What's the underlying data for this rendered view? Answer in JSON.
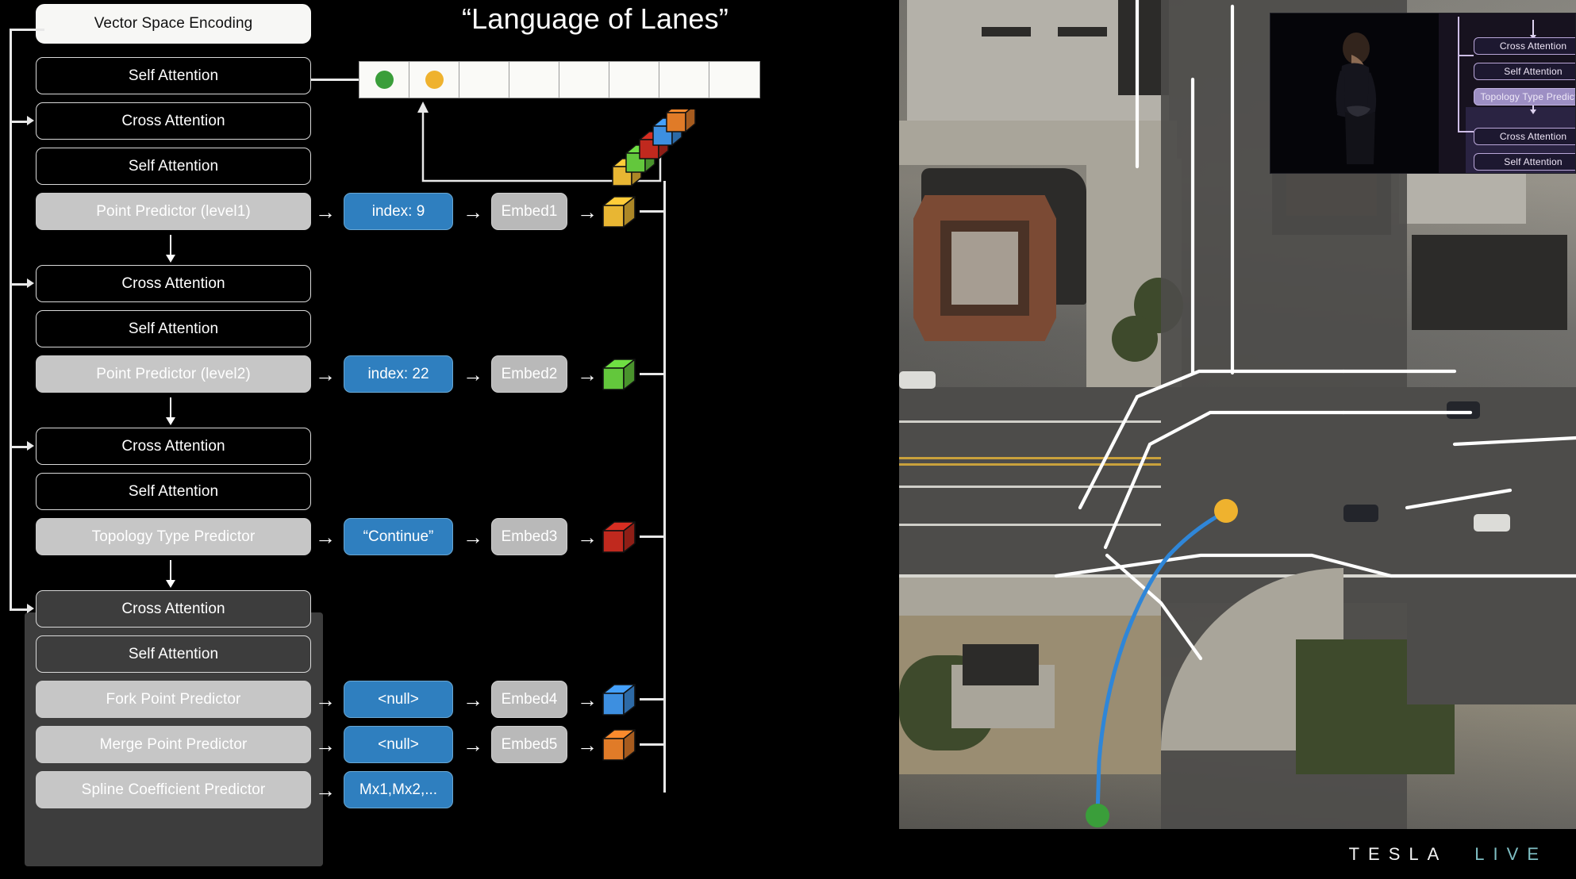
{
  "slide": {
    "title": "“Language of Lanes”"
  },
  "diagram": {
    "head_box": {
      "label": "Vector Space Encoding"
    },
    "groups": [
      {
        "id": "group-1",
        "highlighted": false,
        "rows": [
          {
            "type": "self",
            "label": "Self Attention"
          },
          {
            "type": "cross",
            "label": "Cross Attention"
          },
          {
            "type": "self",
            "label": "Self Attention"
          },
          {
            "type": "pred",
            "label": "Point Predictor (level1)",
            "value": "index: 9",
            "embed": "Embed1",
            "cube_color": "#e8b633"
          }
        ]
      },
      {
        "id": "group-2",
        "highlighted": false,
        "rows": [
          {
            "type": "cross",
            "label": "Cross Attention"
          },
          {
            "type": "self",
            "label": "Self Attention"
          },
          {
            "type": "pred",
            "label": "Point Predictor (level2)",
            "value": "index: 22",
            "embed": "Embed2",
            "cube_color": "#63c73c"
          }
        ]
      },
      {
        "id": "group-3",
        "highlighted": false,
        "rows": [
          {
            "type": "cross",
            "label": "Cross Attention"
          },
          {
            "type": "self",
            "label": "Self Attention"
          },
          {
            "type": "pred",
            "label": "Topology Type Predictor",
            "value": "“Continue”",
            "embed": "Embed3",
            "cube_color": "#c0291e"
          }
        ]
      },
      {
        "id": "group-4",
        "highlighted": true,
        "rows": [
          {
            "type": "cross",
            "label": "Cross Attention"
          },
          {
            "type": "self",
            "label": "Self Attention"
          },
          {
            "type": "pred",
            "label": "Fork Point Predictor",
            "value": "<null>",
            "embed": "Embed4",
            "cube_color": "#3d8fe0"
          },
          {
            "type": "pred",
            "label": "Merge Point Predictor",
            "value": "<null>",
            "embed": "Embed5",
            "cube_color": "#e07b28"
          },
          {
            "type": "pred",
            "label": "Spline Coefficient Predictor",
            "value": "Mx1,Mx2,...",
            "embed": null,
            "cube_color": null
          }
        ]
      }
    ],
    "token_grid": {
      "cell_count": 8,
      "cells": [
        {
          "dot_color": "#3a9e3a"
        },
        {
          "dot_color": "#efb22e"
        },
        {
          "dot_color": null
        },
        {
          "dot_color": null
        },
        {
          "dot_color": null
        },
        {
          "dot_color": null
        },
        {
          "dot_color": null
        },
        {
          "dot_color": null
        }
      ]
    },
    "cube_stack": {
      "name": "token-cube-stack",
      "colors": [
        "#e8b633",
        "#63c73c",
        "#c0291e",
        "#3d8fe0",
        "#e07b28"
      ]
    },
    "arrow_glyph": "→"
  },
  "scene": {
    "name": "aerial-intersection-view",
    "lane_path": {
      "start_marker_color": "#3a9e3a",
      "end_marker_color": "#efb22e",
      "path_color": "#2f86d8"
    },
    "overlay_line_color": "#ffffff"
  },
  "pip": {
    "name": "presenter-inset",
    "slide_boxes": [
      {
        "type": "attn",
        "label": "Cross Attention"
      },
      {
        "type": "attn",
        "label": "Self Attention"
      },
      {
        "type": "pred",
        "label": "Topology Type Predictor"
      },
      {
        "type": "attn",
        "label": "Cross Attention"
      },
      {
        "type": "attn",
        "label": "Self Attention"
      }
    ]
  },
  "logo": {
    "tesla": "TESLA",
    "live": "LIVE"
  }
}
